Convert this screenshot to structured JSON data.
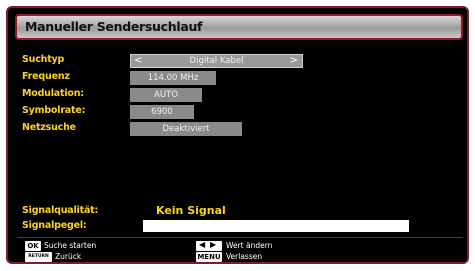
{
  "window": {
    "title": "Manueller Sendersuchlauf"
  },
  "settings": [
    {
      "label": "Suchtyp",
      "value": "Digital Kabel"
    },
    {
      "label": "Frequenz",
      "value": "114.00 MHz"
    },
    {
      "label": "Modulation:",
      "value": "AUTO"
    },
    {
      "label": "Symbolrate:",
      "value": "6900"
    },
    {
      "label": "Netzsuche",
      "value": "Deaktiviert"
    }
  ],
  "selector_arrows": {
    "left": "<",
    "right": ">"
  },
  "signal": {
    "quality_label": "Signalqualität:",
    "quality_value": "Kein Signal",
    "level_label": "Signalpegel:"
  },
  "footer": {
    "ok_key": "OK",
    "ok_text": "Suche starten",
    "return_key": "RETURN",
    "return_text": "Zurück",
    "lr_key_left": "◀",
    "lr_key_right": "▶",
    "lr_text": "Wert ändern",
    "menu_key": "MENU",
    "menu_text": "Verlassen"
  },
  "colors": {
    "label": "#ffd21a",
    "accent": "#8e1b2a",
    "field": "#8a8a8a"
  }
}
